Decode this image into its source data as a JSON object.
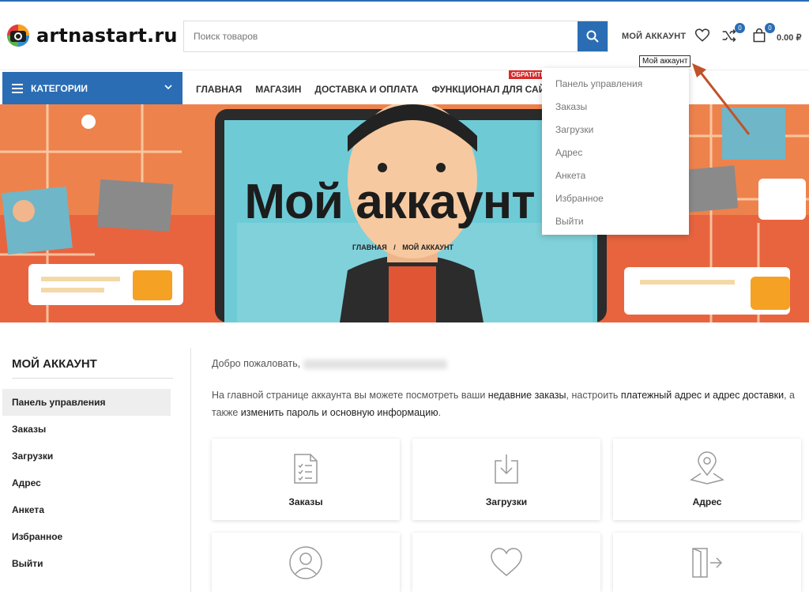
{
  "header": {
    "logo_text": "artnastart.ru",
    "search_placeholder": "Поиск товаров",
    "account_label": "МОЙ АККАУНТ",
    "compare_count": "0",
    "cart_count": "0",
    "cart_total": "0.00 ₽"
  },
  "nav": {
    "categories_label": "КАТЕГОРИИ",
    "items": [
      "ГЛАВНАЯ",
      "МАГАЗИН",
      "ДОСТАВКА И ОПЛАТА",
      "ФУНКЦИОНАЛ ДЛЯ САЙТОВ"
    ],
    "promo_badge": "ОБРАТИТЕ"
  },
  "hero": {
    "title": "Мой аккаунт",
    "breadcrumb": [
      "ГЛАВНАЯ",
      "МОЙ АККАУНТ"
    ],
    "breadcrumb_sep": "/"
  },
  "account_dropdown": {
    "tooltip": "Мой аккаунт",
    "items": [
      "Панель управления",
      "Заказы",
      "Загрузки",
      "Адрес",
      "Анкета",
      "Избранное",
      "Выйти"
    ]
  },
  "sidebar": {
    "title": "МОЙ АККАУНТ",
    "items": [
      "Панель управления",
      "Заказы",
      "Загрузки",
      "Адрес",
      "Анкета",
      "Избранное",
      "Выйти"
    ],
    "active_index": 0
  },
  "main": {
    "welcome": "Добро пожаловать,",
    "intro": {
      "p1": "На главной странице аккаунта вы можете посмотреть ваши ",
      "l1": "недавние заказы",
      "p2": ", настроить ",
      "l2": "платежный адрес и адрес доставки",
      "p3": ", а также ",
      "l3": "изменить пароль и основную информацию",
      "p4": "."
    },
    "cards": [
      {
        "label": "Заказы",
        "icon": "orders-icon"
      },
      {
        "label": "Загрузки",
        "icon": "download-icon"
      },
      {
        "label": "Адрес",
        "icon": "location-icon"
      },
      {
        "label": "",
        "icon": "user-icon"
      },
      {
        "label": "",
        "icon": "heart-icon"
      },
      {
        "label": "",
        "icon": "logout-icon"
      }
    ]
  },
  "colors": {
    "accent": "#2a6db4",
    "promo": "#d82a2a",
    "hero_bg": "#e7643f"
  }
}
